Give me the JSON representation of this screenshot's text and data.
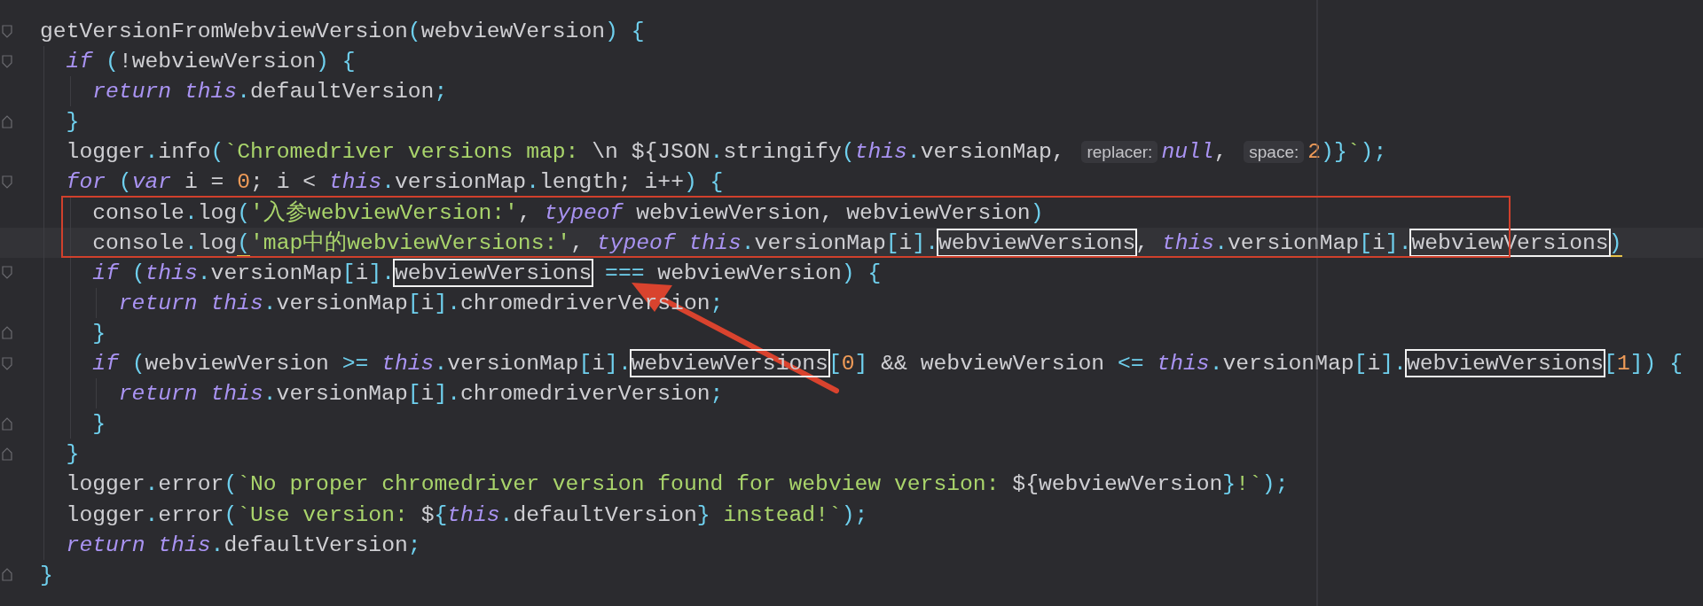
{
  "editor": {
    "lines": [
      {
        "tokens": [
          {
            "kind": "text",
            "text": "getVersionFromWebviewVersion"
          },
          {
            "kind": "punct",
            "text": "("
          },
          {
            "kind": "text",
            "text": "webviewVersion"
          },
          {
            "kind": "punct",
            "text": ") {"
          }
        ],
        "children": [
          {
            "tokens": [
              {
                "kind": "keyword",
                "text": "if"
              },
              {
                "kind": "punct",
                "text": " ("
              },
              {
                "kind": "text",
                "text": "!webviewVersion"
              },
              {
                "kind": "punct",
                "text": ") {"
              }
            ],
            "children": [
              {
                "tokens": [
                  {
                    "kind": "keyword",
                    "text": "return this"
                  },
                  {
                    "kind": "punct",
                    "text": "."
                  },
                  {
                    "kind": "text",
                    "text": "defaultVersion"
                  },
                  {
                    "kind": "punct",
                    "text": ";"
                  }
                ]
              }
            ]
          },
          {
            "tokens": [
              {
                "kind": "punct",
                "text": "}"
              }
            ]
          },
          {
            "tokens": [
              {
                "kind": "text",
                "text": "logger"
              },
              {
                "kind": "punct",
                "text": "."
              },
              {
                "kind": "text",
                "text": "info"
              },
              {
                "kind": "punct",
                "text": "("
              },
              {
                "kind": "string",
                "text": "`Chromedriver versions map: "
              },
              {
                "kind": "text",
                "text": "\\n ${JSON"
              },
              {
                "kind": "punct",
                "text": "."
              },
              {
                "kind": "text",
                "text": "stringify"
              },
              {
                "kind": "punct",
                "text": "("
              },
              {
                "kind": "keyword",
                "text": "this"
              },
              {
                "kind": "punct",
                "text": "."
              },
              {
                "kind": "text",
                "text": "versionMap, "
              },
              {
                "kind": "hint",
                "text": "replacer:"
              },
              {
                "kind": "keyword",
                "text": "null"
              },
              {
                "kind": "text",
                "text": ", "
              },
              {
                "kind": "hint",
                "text": "space:"
              },
              {
                "kind": "number",
                "text": "2"
              },
              {
                "kind": "punct",
                "text": ")}"
              },
              {
                "kind": "string",
                "text": "`"
              },
              {
                "kind": "punct",
                "text": ");"
              }
            ]
          },
          {
            "tokens": [
              {
                "kind": "keyword",
                "text": "for"
              },
              {
                "kind": "punct",
                "text": " ("
              },
              {
                "kind": "keyword",
                "text": "var"
              },
              {
                "kind": "text",
                "text": " i = "
              },
              {
                "kind": "number",
                "text": "0"
              },
              {
                "kind": "text",
                "text": "; i < "
              },
              {
                "kind": "keyword",
                "text": "this"
              },
              {
                "kind": "punct",
                "text": "."
              },
              {
                "kind": "text",
                "text": "versionMap"
              },
              {
                "kind": "punct",
                "text": "."
              },
              {
                "kind": "text",
                "text": "length; i++"
              },
              {
                "kind": "punct",
                "text": ") {"
              }
            ],
            "children": [
              {
                "tokens": [
                  {
                    "kind": "text",
                    "text": "console"
                  },
                  {
                    "kind": "punct",
                    "text": "."
                  },
                  {
                    "kind": "text",
                    "text": "log"
                  },
                  {
                    "kind": "punct",
                    "text": "("
                  },
                  {
                    "kind": "string",
                    "text": "'入参webviewVersion:'"
                  },
                  {
                    "kind": "text",
                    "text": ", "
                  },
                  {
                    "kind": "keyword",
                    "text": "typeof"
                  },
                  {
                    "kind": "text",
                    "text": " webviewVersion, webviewVersion"
                  },
                  {
                    "kind": "punct",
                    "text": ")"
                  }
                ]
              },
              {
                "current": true,
                "tokens": [
                  {
                    "kind": "text",
                    "text": "console"
                  },
                  {
                    "kind": "punct",
                    "text": "."
                  },
                  {
                    "kind": "text",
                    "text": "log"
                  },
                  {
                    "kind": "matched",
                    "text": "("
                  },
                  {
                    "kind": "string",
                    "text": "'map中的webviewVersions:'"
                  },
                  {
                    "kind": "text",
                    "text": ", "
                  },
                  {
                    "kind": "keyword",
                    "text": "typeof this"
                  },
                  {
                    "kind": "punct",
                    "text": "."
                  },
                  {
                    "kind": "text",
                    "text": "versionMap"
                  },
                  {
                    "kind": "punct",
                    "text": "["
                  },
                  {
                    "kind": "text",
                    "text": "i"
                  },
                  {
                    "kind": "punct",
                    "text": "]."
                  },
                  {
                    "kind": "boxed",
                    "text": "webviewVersions"
                  },
                  {
                    "kind": "text",
                    "text": ", "
                  },
                  {
                    "kind": "keyword",
                    "text": "this"
                  },
                  {
                    "kind": "punct",
                    "text": "."
                  },
                  {
                    "kind": "text",
                    "text": "versionMap"
                  },
                  {
                    "kind": "punct",
                    "text": "["
                  },
                  {
                    "kind": "text",
                    "text": "i"
                  },
                  {
                    "kind": "punct",
                    "text": "]."
                  },
                  {
                    "kind": "boxed",
                    "text": "webviewVersions"
                  },
                  {
                    "kind": "matched",
                    "text": ")"
                  }
                ]
              },
              {
                "tokens": [
                  {
                    "kind": "keyword",
                    "text": "if"
                  },
                  {
                    "kind": "punct",
                    "text": " ("
                  },
                  {
                    "kind": "keyword",
                    "text": "this"
                  },
                  {
                    "kind": "punct",
                    "text": "."
                  },
                  {
                    "kind": "text",
                    "text": "versionMap"
                  },
                  {
                    "kind": "punct",
                    "text": "["
                  },
                  {
                    "kind": "text",
                    "text": "i"
                  },
                  {
                    "kind": "punct",
                    "text": "]."
                  },
                  {
                    "kind": "boxed",
                    "text": "webviewVersions"
                  },
                  {
                    "kind": "punct",
                    "text": " ==="
                  },
                  {
                    "kind": "text",
                    "text": " webviewVersion"
                  },
                  {
                    "kind": "punct",
                    "text": ") {"
                  }
                ],
                "children": [
                  {
                    "tokens": [
                      {
                        "kind": "keyword",
                        "text": "return this"
                      },
                      {
                        "kind": "punct",
                        "text": "."
                      },
                      {
                        "kind": "text",
                        "text": "versionMap"
                      },
                      {
                        "kind": "punct",
                        "text": "["
                      },
                      {
                        "kind": "text",
                        "text": "i"
                      },
                      {
                        "kind": "punct",
                        "text": "]."
                      },
                      {
                        "kind": "text",
                        "text": "chromedriverVersion"
                      },
                      {
                        "kind": "punct",
                        "text": ";"
                      }
                    ]
                  }
                ]
              },
              {
                "tokens": [
                  {
                    "kind": "punct",
                    "text": "}"
                  }
                ]
              },
              {
                "tokens": [
                  {
                    "kind": "keyword",
                    "text": "if"
                  },
                  {
                    "kind": "punct",
                    "text": " ("
                  },
                  {
                    "kind": "text",
                    "text": "webviewVersion "
                  },
                  {
                    "kind": "punct",
                    "text": ">="
                  },
                  {
                    "kind": "keyword",
                    "text": " this"
                  },
                  {
                    "kind": "punct",
                    "text": "."
                  },
                  {
                    "kind": "text",
                    "text": "versionMap"
                  },
                  {
                    "kind": "punct",
                    "text": "["
                  },
                  {
                    "kind": "text",
                    "text": "i"
                  },
                  {
                    "kind": "punct",
                    "text": "]."
                  },
                  {
                    "kind": "boxed",
                    "text": "webviewVersions"
                  },
                  {
                    "kind": "punct",
                    "text": "["
                  },
                  {
                    "kind": "number",
                    "text": "0"
                  },
                  {
                    "kind": "punct",
                    "text": "]"
                  },
                  {
                    "kind": "text",
                    "text": " && webviewVersion "
                  },
                  {
                    "kind": "punct",
                    "text": "<="
                  },
                  {
                    "kind": "keyword",
                    "text": " this"
                  },
                  {
                    "kind": "punct",
                    "text": "."
                  },
                  {
                    "kind": "text",
                    "text": "versionMap"
                  },
                  {
                    "kind": "punct",
                    "text": "["
                  },
                  {
                    "kind": "text",
                    "text": "i"
                  },
                  {
                    "kind": "punct",
                    "text": "]."
                  },
                  {
                    "kind": "boxed",
                    "text": "webviewVersions"
                  },
                  {
                    "kind": "punct",
                    "text": "["
                  },
                  {
                    "kind": "number",
                    "text": "1"
                  },
                  {
                    "kind": "punct",
                    "text": "]) {"
                  }
                ],
                "children": [
                  {
                    "tokens": [
                      {
                        "kind": "keyword",
                        "text": "return this"
                      },
                      {
                        "kind": "punct",
                        "text": "."
                      },
                      {
                        "kind": "text",
                        "text": "versionMap"
                      },
                      {
                        "kind": "punct",
                        "text": "["
                      },
                      {
                        "kind": "text",
                        "text": "i"
                      },
                      {
                        "kind": "punct",
                        "text": "]."
                      },
                      {
                        "kind": "text",
                        "text": "chromedriverVersion"
                      },
                      {
                        "kind": "punct",
                        "text": ";"
                      }
                    ]
                  }
                ]
              },
              {
                "tokens": [
                  {
                    "kind": "punct",
                    "text": "}"
                  }
                ]
              }
            ]
          },
          {
            "tokens": [
              {
                "kind": "punct",
                "text": "}"
              }
            ]
          },
          {
            "tokens": [
              {
                "kind": "text",
                "text": "logger"
              },
              {
                "kind": "punct",
                "text": "."
              },
              {
                "kind": "text",
                "text": "error"
              },
              {
                "kind": "punct",
                "text": "("
              },
              {
                "kind": "string",
                "text": "`No proper chromedriver version found for webview version: "
              },
              {
                "kind": "text",
                "text": "${webviewVersion"
              },
              {
                "kind": "punct",
                "text": "}"
              },
              {
                "kind": "string",
                "text": "!`"
              },
              {
                "kind": "punct",
                "text": ");"
              }
            ]
          },
          {
            "tokens": [
              {
                "kind": "text",
                "text": "logger"
              },
              {
                "kind": "punct",
                "text": "."
              },
              {
                "kind": "text",
                "text": "error"
              },
              {
                "kind": "punct",
                "text": "("
              },
              {
                "kind": "string",
                "text": "`Use version: "
              },
              {
                "kind": "text",
                "text": "$"
              },
              {
                "kind": "punct",
                "text": "{"
              },
              {
                "kind": "keyword",
                "text": "this"
              },
              {
                "kind": "punct",
                "text": "."
              },
              {
                "kind": "text",
                "text": "defaultVersion"
              },
              {
                "kind": "punct",
                "text": "}"
              },
              {
                "kind": "string",
                "text": " instead!`"
              },
              {
                "kind": "punct",
                "text": ");"
              }
            ]
          },
          {
            "tokens": [
              {
                "kind": "keyword",
                "text": "return this"
              },
              {
                "kind": "punct",
                "text": "."
              },
              {
                "kind": "text",
                "text": "defaultVersion"
              },
              {
                "kind": "punct",
                "text": ";"
              }
            ]
          }
        ]
      },
      {
        "tokens": [
          {
            "kind": "punct",
            "text": "}"
          }
        ]
      }
    ]
  }
}
